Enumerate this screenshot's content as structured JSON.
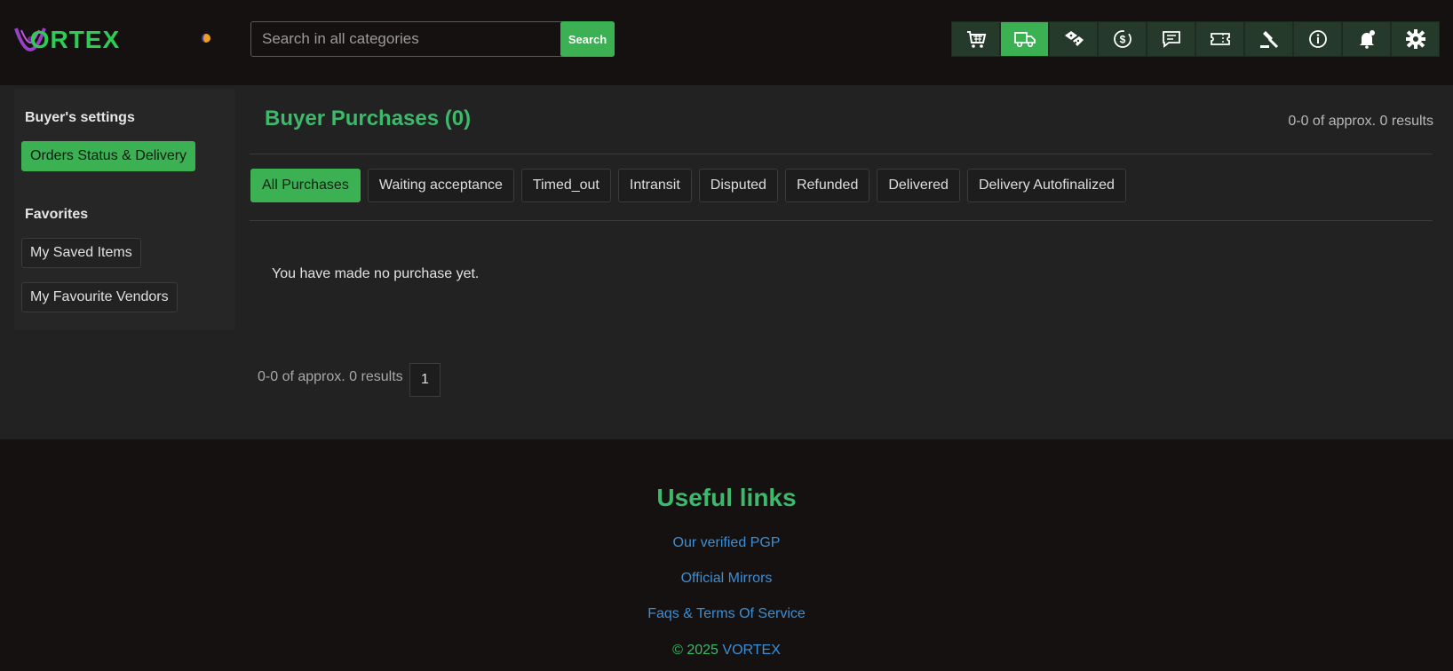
{
  "header": {
    "logo": {
      "first_letter": "V",
      "rest": "ORTEX"
    },
    "search": {
      "placeholder": "Search in all categories",
      "button_label": "Search"
    },
    "nav_icons": [
      {
        "icon": "cart-icon",
        "active": false
      },
      {
        "icon": "delivery-truck-icon",
        "active": true
      },
      {
        "icon": "dice-icon",
        "active": false
      },
      {
        "icon": "dollar-cycle-icon",
        "active": false
      },
      {
        "icon": "message-icon",
        "active": false
      },
      {
        "icon": "ticket-icon",
        "active": false
      },
      {
        "icon": "gavel-icon",
        "active": false
      },
      {
        "icon": "info-icon",
        "active": false
      },
      {
        "icon": "bell-icon",
        "active": false
      },
      {
        "icon": "gear-icon",
        "active": false
      }
    ]
  },
  "sidebar": {
    "buyer_heading": "Buyer's settings",
    "orders_btn": "Orders Status & Delivery",
    "favorites_heading": "Favorites",
    "saved_items_btn": "My Saved Items",
    "favourite_vendors_btn": "My Favourite Vendors"
  },
  "main": {
    "title": "Buyer Purchases (0)",
    "results_top": "0-0 of approx. 0 results",
    "tabs": [
      "All Purchases",
      "Waiting acceptance",
      "Timed_out",
      "Intransit",
      "Disputed",
      "Refunded",
      "Delivered",
      "Delivery Autofinalized"
    ],
    "empty_message": "You have made no purchase yet.",
    "results_bottom": "0-0 of approx. 0 results",
    "page_number": "1"
  },
  "footer": {
    "title": "Useful links",
    "links": [
      "Our verified PGP",
      "Official Mirrors",
      "Faqs & Terms Of Service"
    ],
    "copyright_symbol": "© 2025",
    "copyright_brand": "VORTEX"
  },
  "colors": {
    "accent_green": "#3cb154",
    "title_green": "#3cb96a",
    "link_blue": "#3b8fd6",
    "logo_purple": "#9b3fc7",
    "background": "#151111",
    "panel": "#222222"
  }
}
